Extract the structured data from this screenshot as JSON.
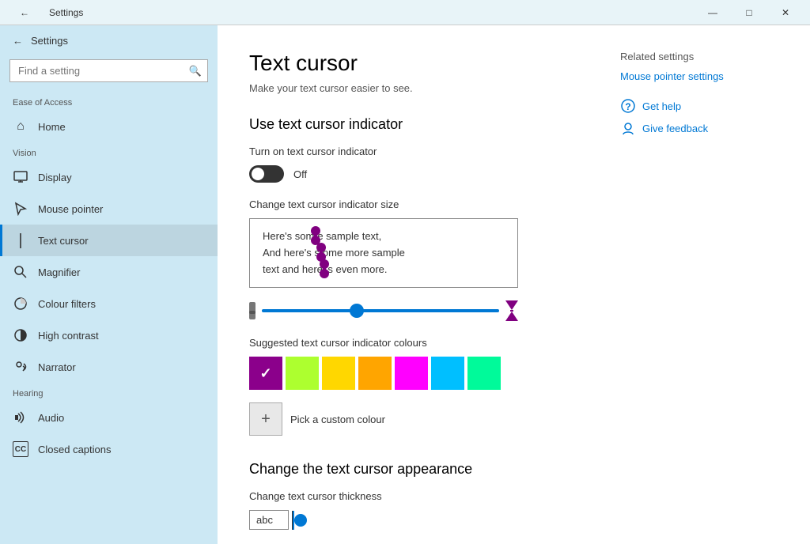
{
  "titlebar": {
    "back_icon": "←",
    "title": "Settings",
    "min_icon": "—",
    "max_icon": "□",
    "close_icon": "✕"
  },
  "sidebar": {
    "back_label": "Settings",
    "search_placeholder": "Find a setting",
    "search_icon": "🔍",
    "current_section": "Ease of Access",
    "vision_label": "Vision",
    "hearing_label": "Hearing",
    "items": [
      {
        "id": "home",
        "label": "Home",
        "icon": "⌂"
      },
      {
        "id": "display",
        "label": "Display",
        "icon": "🖥"
      },
      {
        "id": "mouse-pointer",
        "label": "Mouse pointer",
        "icon": "🖱"
      },
      {
        "id": "text-cursor",
        "label": "Text cursor",
        "icon": "|",
        "active": true
      },
      {
        "id": "magnifier",
        "label": "Magnifier",
        "icon": "🔍"
      },
      {
        "id": "colour-filters",
        "label": "Colour filters",
        "icon": "☀"
      },
      {
        "id": "high-contrast",
        "label": "High contrast",
        "icon": "☀"
      },
      {
        "id": "narrator",
        "label": "Narrator",
        "icon": "💬"
      },
      {
        "id": "audio",
        "label": "Audio",
        "icon": "🔊"
      },
      {
        "id": "closed-captions",
        "label": "Closed captions",
        "icon": "CC"
      }
    ]
  },
  "content": {
    "page_title": "Text cursor",
    "page_subtitle": "Make your text cursor easier to see.",
    "section1_title": "Use text cursor indicator",
    "toggle_label": "Turn on text cursor indicator",
    "toggle_state": "Off",
    "size_label": "Change text cursor indicator size",
    "sample_lines": [
      "Here's some sample text,",
      "And here's some more sample",
      "text and here's even more."
    ],
    "colours_label": "Suggested text cursor indicator colours",
    "swatches": [
      {
        "color": "#8B008B",
        "selected": true
      },
      {
        "color": "#ADFF2F",
        "selected": false
      },
      {
        "color": "#FFD700",
        "selected": false
      },
      {
        "color": "#FFA500",
        "selected": false
      },
      {
        "color": "#FF00FF",
        "selected": false
      },
      {
        "color": "#00BFFF",
        "selected": false
      },
      {
        "color": "#00FA9A",
        "selected": false
      }
    ],
    "custom_colour_label": "Pick a custom colour",
    "section2_title": "Change the text cursor appearance",
    "thickness_label": "Change text cursor thickness",
    "thickness_preview_text": "abc"
  },
  "related": {
    "title": "Related settings",
    "mouse_pointer_link": "Mouse pointer settings",
    "get_help_label": "Get help",
    "give_feedback_label": "Give feedback"
  }
}
